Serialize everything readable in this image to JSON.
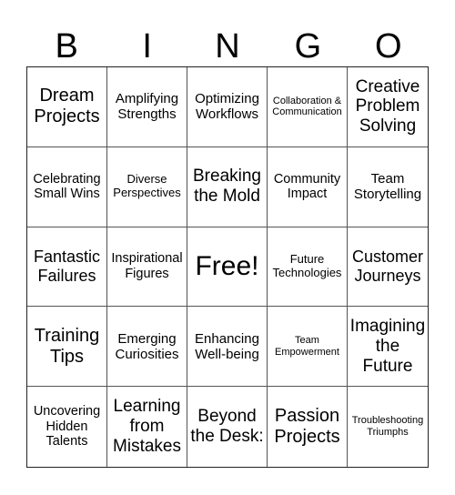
{
  "header": [
    "B",
    "I",
    "N",
    "G",
    "O"
  ],
  "cells": [
    "Dream Projects",
    "Amplifying Strengths",
    "Optimizing Workflows",
    "Collaboration & Communication",
    "Creative Problem Solving",
    "Celebrating Small Wins",
    "Diverse Perspectives",
    "Breaking the Mold",
    "Community Impact",
    "Team Storytelling",
    "Fantastic Failures",
    "Inspirational Figures",
    "Free!",
    "Future Technologies",
    "Customer Journeys",
    "Training Tips",
    "Emerging Curiosities",
    "Enhancing Well-being",
    "Team Empowerment",
    "Imagining the Future",
    "Uncovering Hidden Talents",
    "Learning from Mistakes",
    "Beyond the Desk:",
    "Passion Projects",
    "Troubleshooting Triumphs"
  ]
}
